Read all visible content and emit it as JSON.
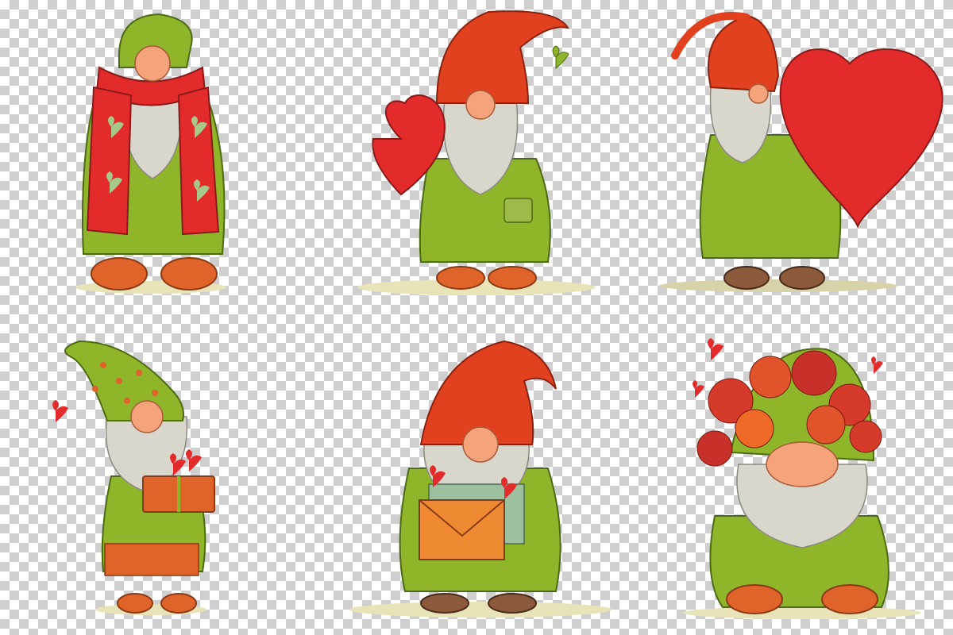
{
  "canvas": {
    "background": "transparency-checkerboard",
    "checker_colors": [
      "#ffffff",
      "#cfcfcf"
    ]
  },
  "palette": {
    "coat_green": "#8fb52a",
    "coat_dark": "#5d7d1a",
    "hat_red": "#e2411f",
    "hat_orange": "#ef6a26",
    "heart_red": "#e32b2b",
    "beard": "#d9d6cc",
    "skin": "#f4a37a",
    "boot_orange": "#e0642a",
    "boot_brown": "#8a5a3a",
    "ground": "#e9e3b8"
  },
  "gnomes": [
    {
      "id": "gnome-1",
      "hat": "green",
      "accessory": "red-heart-scarf"
    },
    {
      "id": "gnome-2",
      "hat": "red",
      "accessory": "red-heart-held"
    },
    {
      "id": "gnome-3",
      "hat": "red",
      "accessory": "large-red-heart"
    },
    {
      "id": "gnome-4",
      "hat": "green-polka",
      "accessory": "gift-box-with-hearts"
    },
    {
      "id": "gnome-5",
      "hat": "red",
      "accessory": "orange-envelope"
    },
    {
      "id": "gnome-6",
      "hat": "green",
      "accessory": "rose-bouquet"
    }
  ],
  "icons": [
    "heart-icon",
    "envelope-icon",
    "gift-icon",
    "rose-icon"
  ]
}
